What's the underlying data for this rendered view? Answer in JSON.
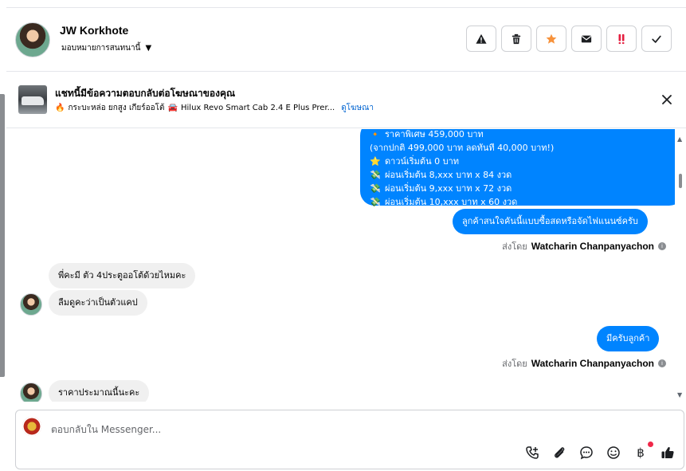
{
  "header": {
    "contact_name": "JW Korkhote",
    "assign_label": "มอบหมายการสนทนานี้",
    "actions": [
      {
        "name": "report-button",
        "icon": "warning-icon"
      },
      {
        "name": "delete-button",
        "icon": "trash-icon"
      },
      {
        "name": "star-button",
        "icon": "star-icon"
      },
      {
        "name": "mark-unread-button",
        "icon": "envelope-icon"
      },
      {
        "name": "flag-spam-button",
        "icon": "exclamation-icon"
      },
      {
        "name": "mark-done-button",
        "icon": "check-icon"
      }
    ]
  },
  "ad_banner": {
    "title": "แชทนี้มีข้อความตอบกลับต่อโฆษณาของคุณ",
    "subtitle": "กระบะหล่อ ยกสูง เกียร์ออโต้",
    "product": "Hilux Revo Smart Cab 2.4 E Plus Prer...",
    "view_ad": "ดูโฆษณา"
  },
  "messages": {
    "promo_lines": [
      {
        "emoji": "🔸",
        "text": "ราคาพิเศษ 459,000 บาท"
      },
      {
        "emoji": "",
        "text": "(จากปกติ 499,000 บาท ลดทันที 40,000 บาท!)"
      },
      {
        "emoji": "⭐",
        "text": "ดาวน์เริ่มต้น 0 บาท"
      },
      {
        "emoji": "💸",
        "text": "ผ่อนเริ่มต้น 8,xxx บาท x 84 งวด"
      },
      {
        "emoji": "💸",
        "text": "ผ่อนเริ่มต้น 9,xxx บาท x 72 งวด"
      },
      {
        "emoji": "💸",
        "text": "ผ่อนเริ่มต้น 10,xxx บาท x 60 งวด"
      }
    ],
    "reply_1": "ลูกค้าสนใจคันนี้แบบซื้อสดหรือจัดไฟแนนซ์ครับ",
    "incoming_1": "พี่คะมี ตัว 4ประตูออโต้ด้วยไหมคะ",
    "incoming_2": "ลืมดูคะว่าเป็นตัวแคป",
    "reply_2": "มีครับลูกค้า",
    "incoming_3": "ราคาประมาณนี้นะคะ",
    "sent_by_prefix": "ส่งโดย",
    "sent_by_name": "Watcharin Chanpanyachon"
  },
  "composer": {
    "placeholder": "ตอบกลับใน Messenger...",
    "tools": [
      "call-add-icon",
      "paperclip-icon",
      "saved-reply-icon",
      "emoji-icon",
      "baht-icon",
      "thumbs-up-icon"
    ]
  },
  "colors": {
    "outgoing_bubble": "#0084ff",
    "incoming_bubble": "#f0f0f0",
    "star": "#f7923b",
    "spam": "#e41e3f",
    "link": "#0064d1"
  }
}
